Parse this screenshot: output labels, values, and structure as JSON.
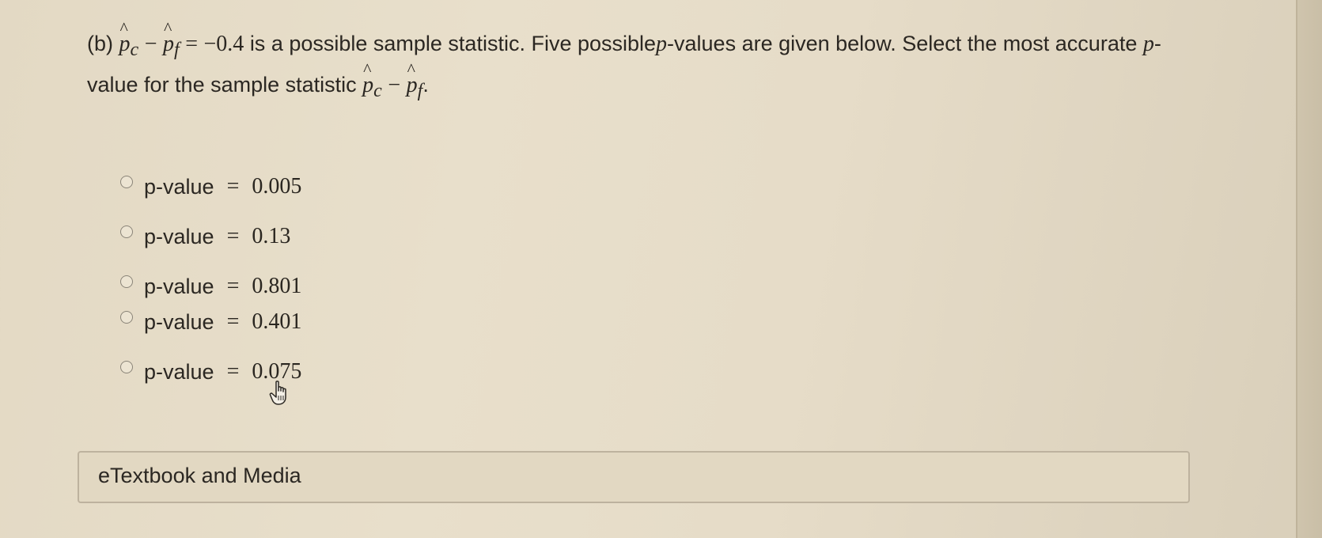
{
  "question": {
    "part_label": "(b)",
    "p_symbol": "p",
    "sub_c": "c",
    "sub_f": "f",
    "minus": "−",
    "equals": "=",
    "value": "−0.4",
    "text_1": "is a possible sample statistic. Five possible",
    "p_italic": "p",
    "text_2": "-values are given below. Select the most accurate",
    "p_italic_2": "p",
    "text_3": "-",
    "text_4": "value for the sample statistic",
    "end_period": "."
  },
  "options": [
    {
      "label": "p-value",
      "equals": "=",
      "value": "0.005"
    },
    {
      "label": "p-value",
      "equals": "=",
      "value": "0.13"
    },
    {
      "label": "p-value",
      "equals": "=",
      "value": "0.801"
    },
    {
      "label": "p-value",
      "equals": "=",
      "value": "0.401"
    },
    {
      "label": "p-value",
      "equals": "=",
      "value": "0.075"
    }
  ],
  "media": {
    "label": "eTextbook and Media"
  }
}
